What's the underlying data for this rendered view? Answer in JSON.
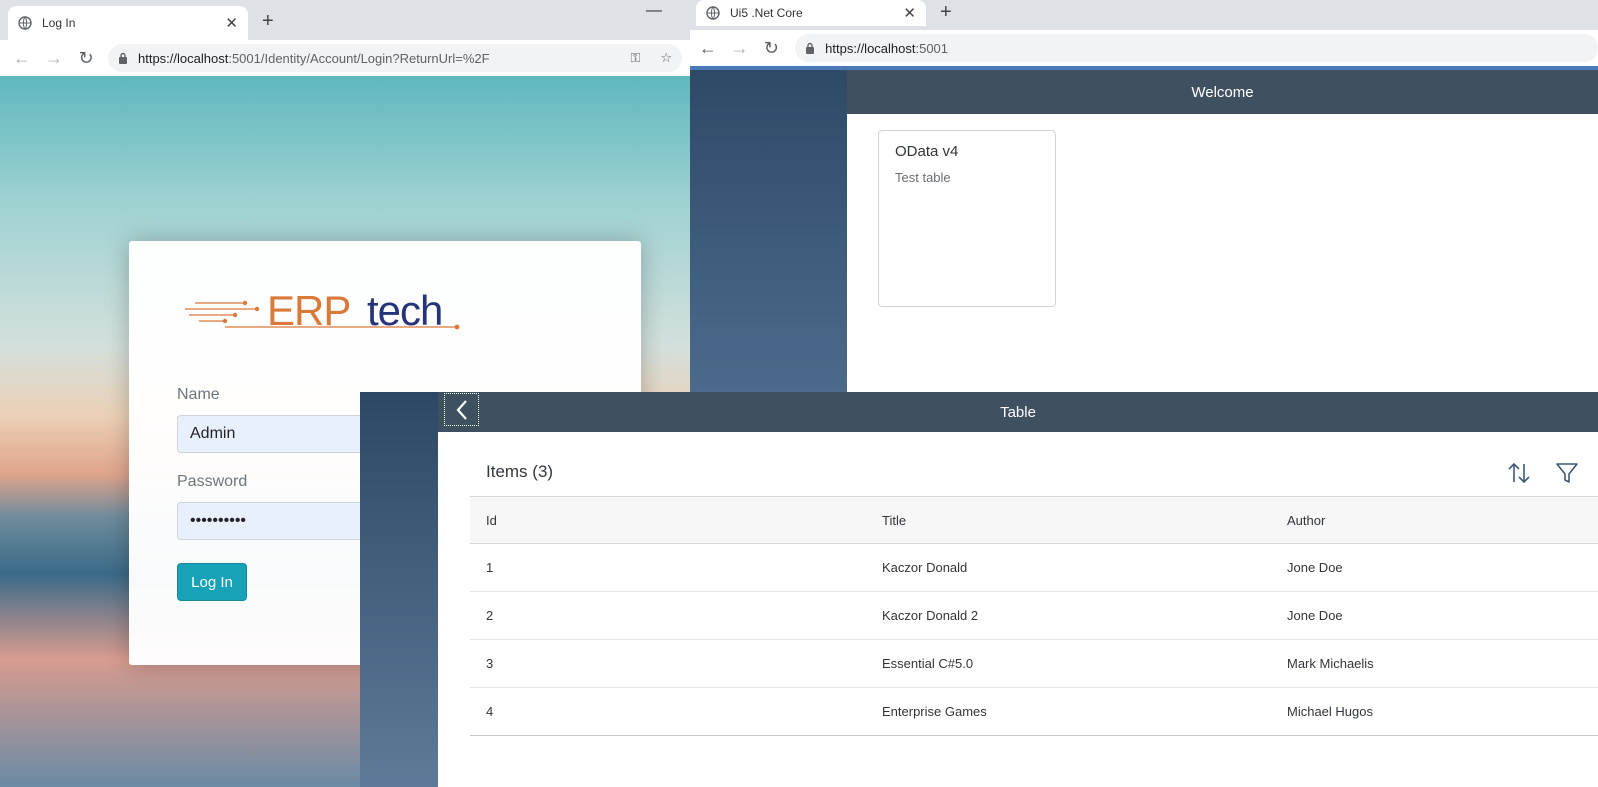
{
  "login_window": {
    "tab": {
      "title": "Log In"
    },
    "address": {
      "host": "https://localhost",
      "rest": ":5001/Identity/Account/Login?ReturnUrl=%2F"
    },
    "logo": {
      "part1": "ERP",
      "part2": "tech"
    },
    "form": {
      "name_label": "Name",
      "name_value": "Admin",
      "password_label": "Password",
      "password_value": "••••••••••",
      "submit_label": "Log In"
    }
  },
  "ui5_window": {
    "tab": {
      "title": "Ui5 .Net Core"
    },
    "address": {
      "host": "https://localhost",
      "rest": ":5001"
    },
    "shell_title": "Welcome",
    "tile": {
      "title": "OData v4",
      "subtitle": "Test table"
    }
  },
  "table_window": {
    "header_title": "Table",
    "table_title": "Items (3)",
    "columns": [
      "Id",
      "Title",
      "Author"
    ],
    "rows": [
      {
        "id": "1",
        "title": "Kaczor Donald",
        "author": "Jone Doe"
      },
      {
        "id": "2",
        "title": "Kaczor Donald 2",
        "author": "Jone Doe"
      },
      {
        "id": "3",
        "title": "Essential C#5.0",
        "author": "Mark Michaelis"
      },
      {
        "id": "4",
        "title": "Enterprise Games",
        "author": "Michael Hugos"
      }
    ]
  },
  "colors": {
    "ui5_header": "#3f5161",
    "login_button": "#17a2b8",
    "logo_orange": "#d9793a",
    "logo_blue": "#25357a"
  }
}
